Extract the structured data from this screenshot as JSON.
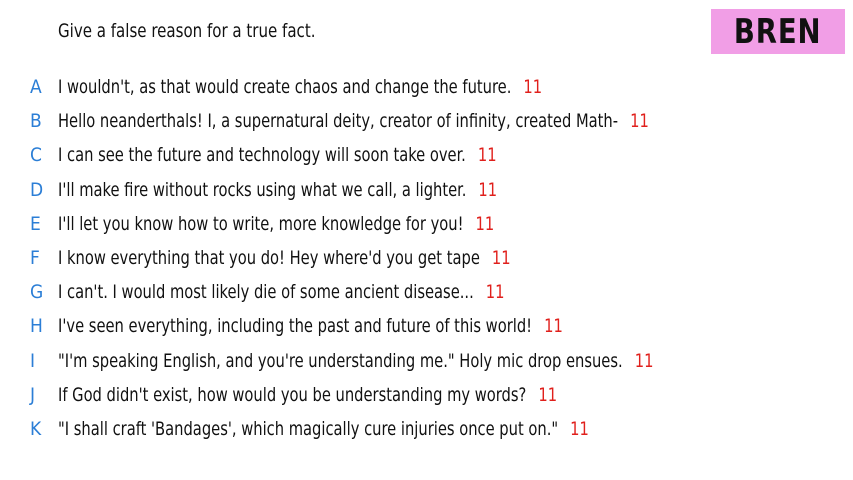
{
  "prompt": "Give a false reason for a true fact.",
  "player_name": "BREN",
  "answers": [
    {
      "letter": "A",
      "text": "I wouldn't, as that would create chaos and change the future.",
      "score": "11"
    },
    {
      "letter": "B",
      "text": "Hello neanderthals! I, a supernatural deity, creator of infinity, created Math-",
      "score": "11"
    },
    {
      "letter": "C",
      "text": "I can see the future and technology will soon take over.",
      "score": "11"
    },
    {
      "letter": "D",
      "text": "I'll make fire without rocks using what we call, a lighter.",
      "score": "11"
    },
    {
      "letter": "E",
      "text": "I'll let you know how to write, more knowledge for you!",
      "score": "11"
    },
    {
      "letter": "F",
      "text": "I know everything that you do! Hey where'd you get tape",
      "score": "11"
    },
    {
      "letter": "G",
      "text": "I can't. I would most likely die of some ancient disease...",
      "score": "11"
    },
    {
      "letter": "H",
      "text": "I've seen everything, including the past and future of this world!",
      "score": "11"
    },
    {
      "letter": "I",
      "text": "\"I'm speaking English, and you're understanding me.\" Holy mic drop ensues.",
      "score": "11"
    },
    {
      "letter": "J",
      "text": "If God didn't exist, how would you be understanding my words?",
      "score": "11"
    },
    {
      "letter": "K",
      "text": "\"I shall craft 'Bandages', which magically cure injuries once put on.\"",
      "score": "11"
    }
  ],
  "colors": {
    "letter": "#2b7ed6",
    "score": "#e0201c",
    "badge_background": "#f19ee6"
  }
}
